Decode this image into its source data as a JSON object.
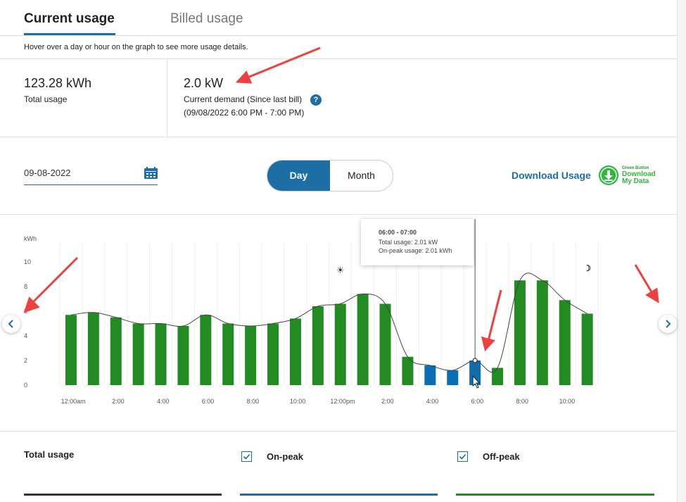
{
  "tabs": [
    {
      "label": "Current usage",
      "active": true
    },
    {
      "label": "Billed usage",
      "active": false
    }
  ],
  "hint": "Hover over a day or hour on the graph to see more usage details.",
  "stats": {
    "total_usage_value": "123.28 kWh",
    "total_usage_label": "Total usage",
    "demand_value": "2.0 kW",
    "demand_label": "Current demand (Since last bill)",
    "demand_range": "(09/08/2022 6:00 PM - 7:00 PM)",
    "help_glyph": "?"
  },
  "controls": {
    "date_value": "09-08-2022",
    "toggle": {
      "day": "Day",
      "month": "Month",
      "selected": "Day"
    },
    "download_usage": "Download Usage",
    "green_button": {
      "small": "Green Button",
      "line1": "Download",
      "line2": "My Data"
    }
  },
  "tooltip": {
    "title": "06:00 - 07:00",
    "line1": "Total usage: 2.01 kW",
    "line2": "On-peak usage: 2.01 kWh"
  },
  "icons": {
    "sun": "☀",
    "moon": "☽"
  },
  "colors": {
    "accent": "#1c6ea4",
    "off_peak": "#228b22",
    "on_peak": "#0a6eb4",
    "green_button": "#2fb83e"
  },
  "chart_data": {
    "type": "bar",
    "ylabel": "kWh",
    "yticks": [
      "10",
      "8",
      "6",
      "4",
      "2",
      "0"
    ],
    "ylim": [
      0,
      10
    ],
    "xtick_labels": [
      "12:00am",
      "2:00",
      "4:00",
      "6:00",
      "8:00",
      "10:00",
      "12:00pm",
      "2:00",
      "4:00",
      "6:00",
      "8:00",
      "10:00"
    ],
    "values": [
      5.7,
      5.9,
      5.5,
      5.0,
      5.0,
      4.8,
      5.7,
      5.0,
      4.8,
      5.0,
      5.4,
      6.4,
      6.6,
      7.4,
      6.6,
      2.3,
      1.6,
      1.2,
      2.0,
      1.4,
      8.5,
      8.5,
      6.9,
      5.8
    ],
    "peak_type": [
      "off",
      "off",
      "off",
      "off",
      "off",
      "off",
      "off",
      "off",
      "off",
      "off",
      "off",
      "off",
      "off",
      "off",
      "off",
      "off",
      "on",
      "on",
      "on",
      "off",
      "off",
      "off",
      "off",
      "off"
    ],
    "hovered_index": 18,
    "demand_curve_values": [
      5.7,
      5.9,
      5.5,
      5.0,
      5.0,
      4.8,
      5.7,
      5.0,
      4.8,
      5.0,
      5.4,
      6.4,
      6.6,
      7.4,
      6.6,
      2.3,
      1.6,
      1.2,
      2.0,
      1.4,
      8.5,
      8.5,
      6.9,
      5.8
    ]
  },
  "legend": {
    "total_usage": "Total usage",
    "on_peak": "On-peak",
    "off_peak": "Off-peak"
  }
}
